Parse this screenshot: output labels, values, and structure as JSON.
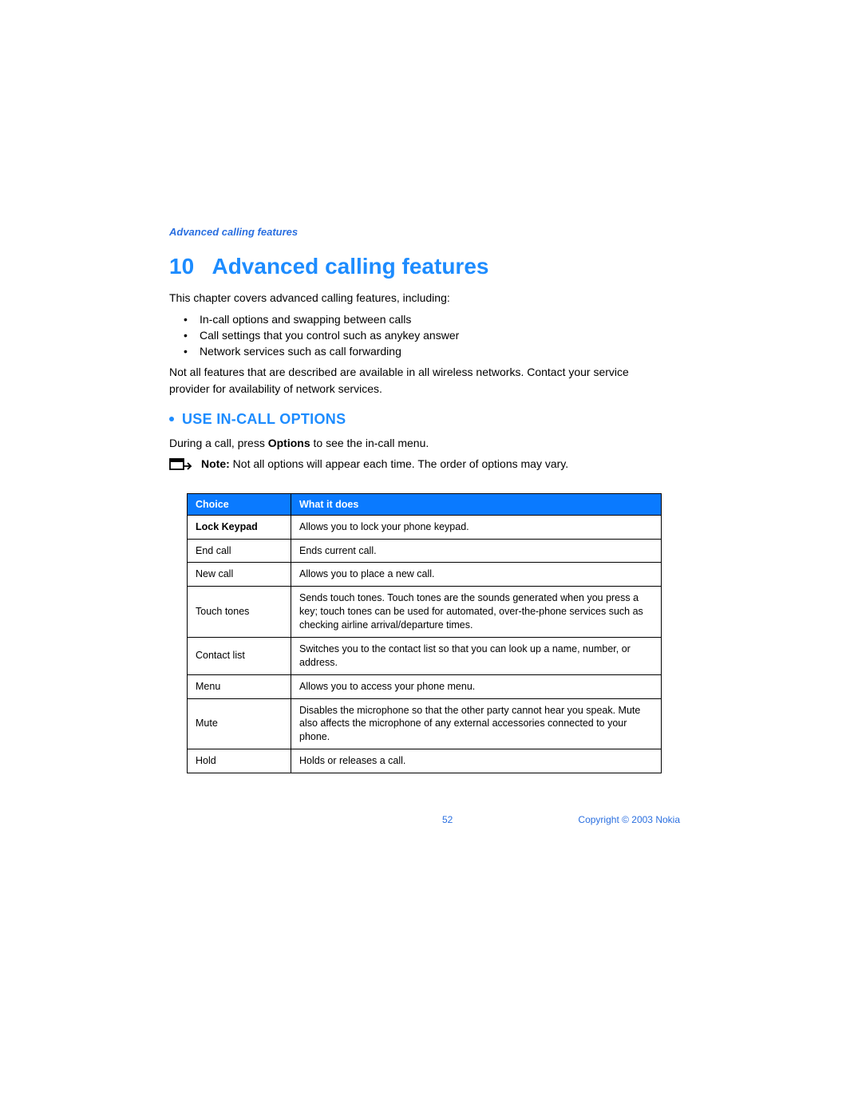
{
  "runningHeader": "Advanced calling features",
  "chapterNumber": "10",
  "chapterTitle": "Advanced calling features",
  "introText": "This chapter covers advanced calling features, including:",
  "introBullets": [
    "In-call options and swapping between calls",
    "Call settings that you control such as anykey answer",
    "Network services such as call forwarding"
  ],
  "introPara": "Not all features that are described are available in all wireless networks. Contact your service provider for availability of network services.",
  "sectionHeading": "USE IN-CALL OPTIONS",
  "duringCallPrefix": "During a call, press ",
  "duringCallBold": "Options",
  "duringCallSuffix": " to see the in-call menu.",
  "noteLabel": "Note:",
  "noteText": " Not all options will appear each time. The order of options may vary.",
  "tableHeaders": {
    "choice": "Choice",
    "whatItDoes": "What it does"
  },
  "tableRows": [
    {
      "choice": "Lock Keypad",
      "bold": true,
      "desc": "Allows you to lock your phone keypad."
    },
    {
      "choice": "End call",
      "bold": false,
      "desc": "Ends current call."
    },
    {
      "choice": "New call",
      "bold": false,
      "desc": "Allows you to place a new call."
    },
    {
      "choice": "Touch tones",
      "bold": false,
      "desc": "Sends touch tones. Touch tones are the sounds generated when you press a key; touch tones can be used for automated, over-the-phone services such as checking airline arrival/departure times."
    },
    {
      "choice": "Contact list",
      "bold": false,
      "desc": "Switches you to the contact list so that you can look up a name, number, or address."
    },
    {
      "choice": "Menu",
      "bold": false,
      "desc": "Allows you to access your phone menu."
    },
    {
      "choice": "Mute",
      "bold": false,
      "desc": "Disables the microphone so that the other party cannot hear you speak. Mute also affects the microphone of any external accessories connected to your phone."
    },
    {
      "choice": "Hold",
      "bold": false,
      "desc": "Holds or releases a call."
    }
  ],
  "pageNumber": "52",
  "copyright": "Copyright © 2003 Nokia"
}
